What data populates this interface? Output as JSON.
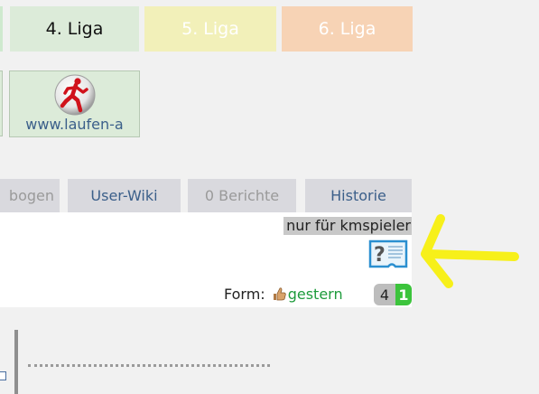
{
  "league_tabs": [
    {
      "label": "4. Liga"
    },
    {
      "label": "5. Liga"
    },
    {
      "label": "6. Liga"
    }
  ],
  "links": [
    {
      "label": "www.laufen-a",
      "icon": "runner-logo-icon"
    }
  ],
  "profile_tabs": [
    {
      "label": "bogen"
    },
    {
      "label": "User-Wiki"
    },
    {
      "label": "0 Berichte"
    },
    {
      "label": "Historie"
    }
  ],
  "panel": {
    "restricted_note": "nur für kmspieler",
    "card_icon": "question-card-icon",
    "form_label": "Form:",
    "form_icon": "thumb-icon",
    "form_value": "gestern",
    "score_left": "4",
    "score_right": "1"
  },
  "annotation": {
    "icon": "yellow-arrow-icon",
    "color": "#f7f01a"
  },
  "colors": {
    "liga4": "#dcebd9",
    "liga5": "#f2f0b9",
    "liga6": "#f7d3b5",
    "link": "#3b5f8a",
    "form_green": "#1e9b3c",
    "score_green": "#3cc43c"
  }
}
